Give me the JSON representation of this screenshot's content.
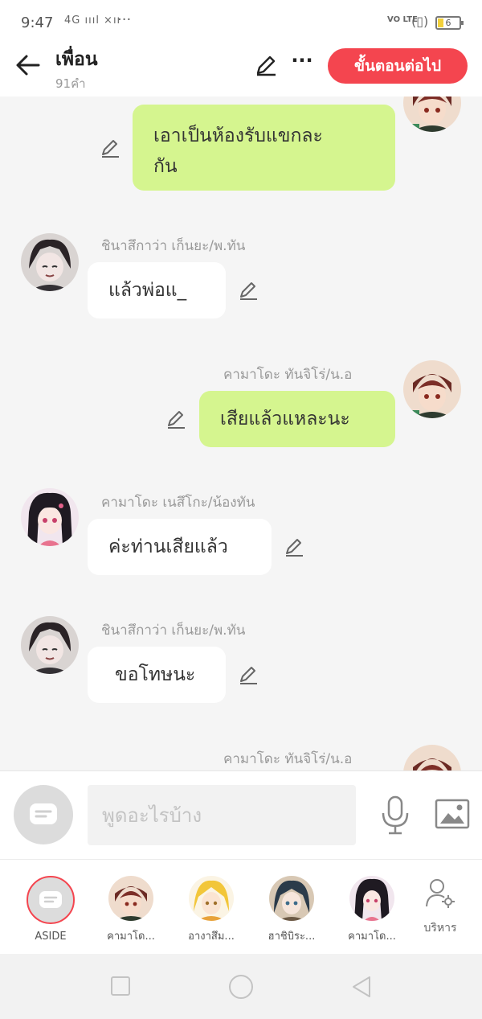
{
  "status_bar": {
    "time": "9:47",
    "signal_text": "4G ıııl ×ıı",
    "dots": "···",
    "volte": "VO LTE",
    "battery": "6"
  },
  "header": {
    "title": "เพื่อน",
    "subtitle": "91คำ",
    "more_label": "···",
    "next_label": "ขั้นตอนต่อไป",
    "accent_color": "#f4454f"
  },
  "messages": [
    {
      "side": "right",
      "sender": "",
      "text_line1": "เอาเป็นห้องรับแขกละ",
      "text_line2": "กัน",
      "avatar": "tanjiro"
    },
    {
      "side": "left",
      "sender": "ชินาสึกาว่า เก็นยะ/พ.ทัน",
      "text": "แล้วพ่อแ_",
      "avatar": "genya"
    },
    {
      "side": "right",
      "sender": "คามาโดะ ทันจิโร่/น.อ",
      "text": "เสียแล้วแหละนะ",
      "avatar": "tanjiro"
    },
    {
      "side": "left",
      "sender": "คามาโดะ เนสึโกะ/น้องทัน",
      "text": "ค่ะท่านเสียแล้ว",
      "avatar": "nezuko"
    },
    {
      "side": "left",
      "sender": "ชินาสึกาว่า เก็นยะ/พ.ทัน",
      "text": "ขอโทษนะ",
      "avatar": "genya"
    },
    {
      "side": "right",
      "sender": "คามาโดะ ทันจิโร่/น.อ",
      "text": "",
      "avatar": "tanjiro"
    }
  ],
  "input": {
    "placeholder": "พูดอะไรบ้าง"
  },
  "characters": [
    {
      "label": "ASIDE"
    },
    {
      "label": "คามาโด..."
    },
    {
      "label": "อางาสึม..."
    },
    {
      "label": "ฮาชิบิระ..."
    },
    {
      "label": "คามาโด..."
    }
  ],
  "manage_label": "บริหาร",
  "colors": {
    "bubble_right": "#d5f58f",
    "bubble_left": "#ffffff",
    "chat_bg": "#f5f5f5"
  }
}
